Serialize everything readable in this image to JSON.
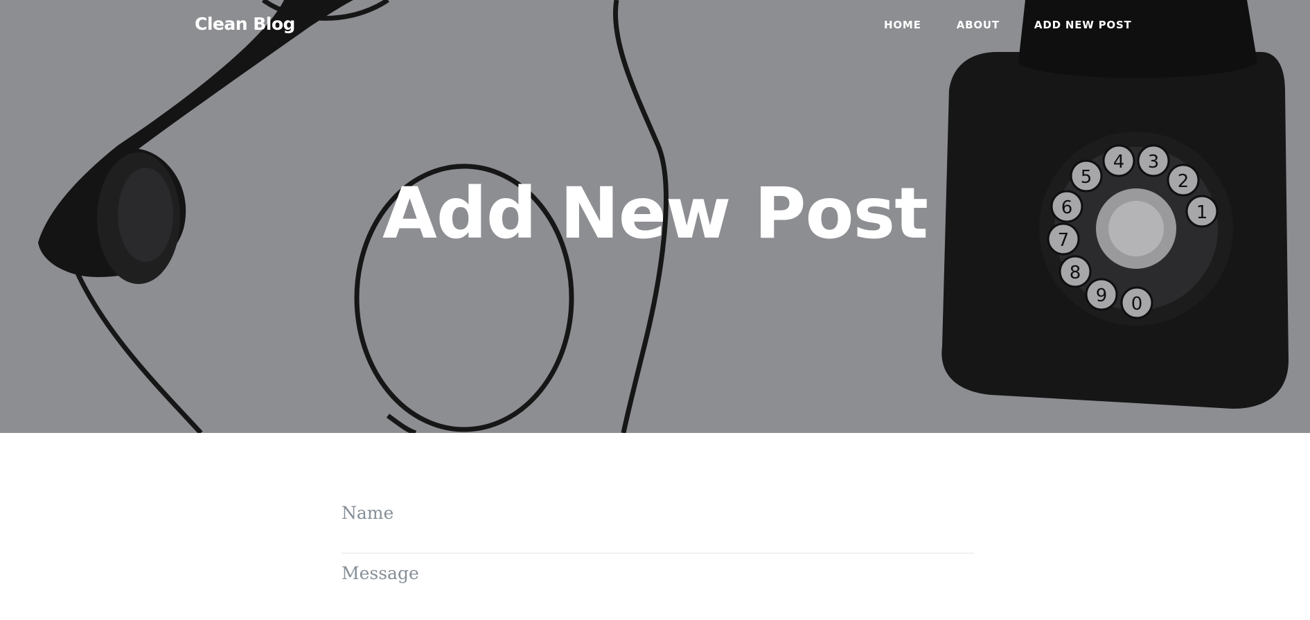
{
  "navbar": {
    "brand": "Clean Blog",
    "links": [
      {
        "label": "HOME"
      },
      {
        "label": "ABOUT"
      },
      {
        "label": "ADD NEW POST"
      }
    ]
  },
  "masthead": {
    "heading": "Add New Post",
    "background_image": "black rotary telephone on grey background"
  },
  "form": {
    "name_placeholder": "Name",
    "message_placeholder": "Message"
  },
  "colors": {
    "masthead_overlay": "#8d8e92",
    "nav_text": "#ffffff",
    "placeholder": "#868e96",
    "divider": "#e4e4e4"
  }
}
